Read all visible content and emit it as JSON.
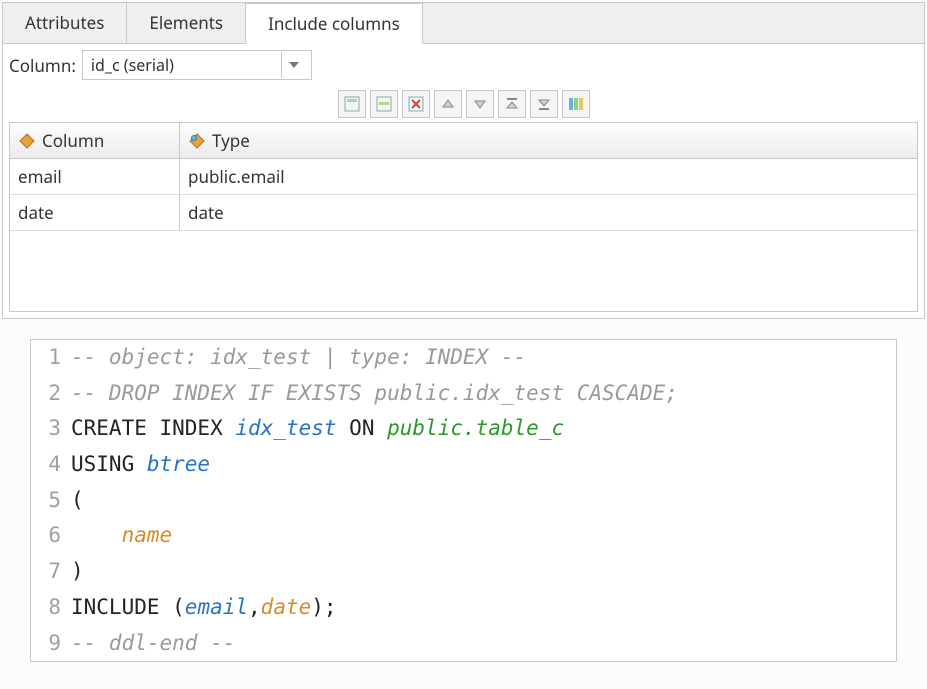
{
  "tabs": {
    "attributes": "Attributes",
    "elements": "Elements",
    "include": "Include columns"
  },
  "column_label": "Column:",
  "column_combo_value": "id_c (serial)",
  "toolbar": {
    "add": "add-row",
    "edit": "edit-row",
    "delete": "delete-row",
    "up": "move-up",
    "down": "move-down",
    "top": "move-top",
    "bottom": "move-bottom",
    "import": "import"
  },
  "table": {
    "headers": {
      "column": "Column",
      "type": "Type"
    },
    "rows": [
      {
        "column": "email",
        "type": "public.email"
      },
      {
        "column": "date",
        "type": "date"
      }
    ]
  },
  "code": [
    {
      "n": "1",
      "segments": [
        {
          "cls": "c-comment",
          "t": "-- object: idx_test | type: INDEX --"
        }
      ]
    },
    {
      "n": "2",
      "segments": [
        {
          "cls": "c-comment",
          "t": "-- DROP INDEX IF EXISTS public.idx_test CASCADE;"
        }
      ]
    },
    {
      "n": "3",
      "segments": [
        {
          "cls": "c-kw",
          "t": "CREATE INDEX "
        },
        {
          "cls": "c-ident-blue",
          "t": "idx_test"
        },
        {
          "cls": "c-kw-on",
          "t": " ON "
        },
        {
          "cls": "c-ident-green",
          "t": "public.table_c"
        }
      ]
    },
    {
      "n": "4",
      "segments": [
        {
          "cls": "c-kw",
          "t": "USING "
        },
        {
          "cls": "c-ident-blue",
          "t": "btree"
        }
      ]
    },
    {
      "n": "5",
      "segments": [
        {
          "cls": "c-kw",
          "t": "("
        }
      ]
    },
    {
      "n": "6",
      "segments": [
        {
          "cls": "c-kw",
          "t": "    "
        },
        {
          "cls": "c-ident-orange",
          "t": "name"
        }
      ]
    },
    {
      "n": "7",
      "segments": [
        {
          "cls": "c-kw",
          "t": ")"
        }
      ]
    },
    {
      "n": "8",
      "segments": [
        {
          "cls": "c-kw",
          "t": "INCLUDE ("
        },
        {
          "cls": "c-ident-blue",
          "t": "email"
        },
        {
          "cls": "c-kw",
          "t": ","
        },
        {
          "cls": "c-ident-orange",
          "t": "date"
        },
        {
          "cls": "c-kw",
          "t": ");"
        }
      ]
    },
    {
      "n": "9",
      "segments": [
        {
          "cls": "c-comment",
          "t": "-- ddl-end --"
        }
      ]
    }
  ]
}
